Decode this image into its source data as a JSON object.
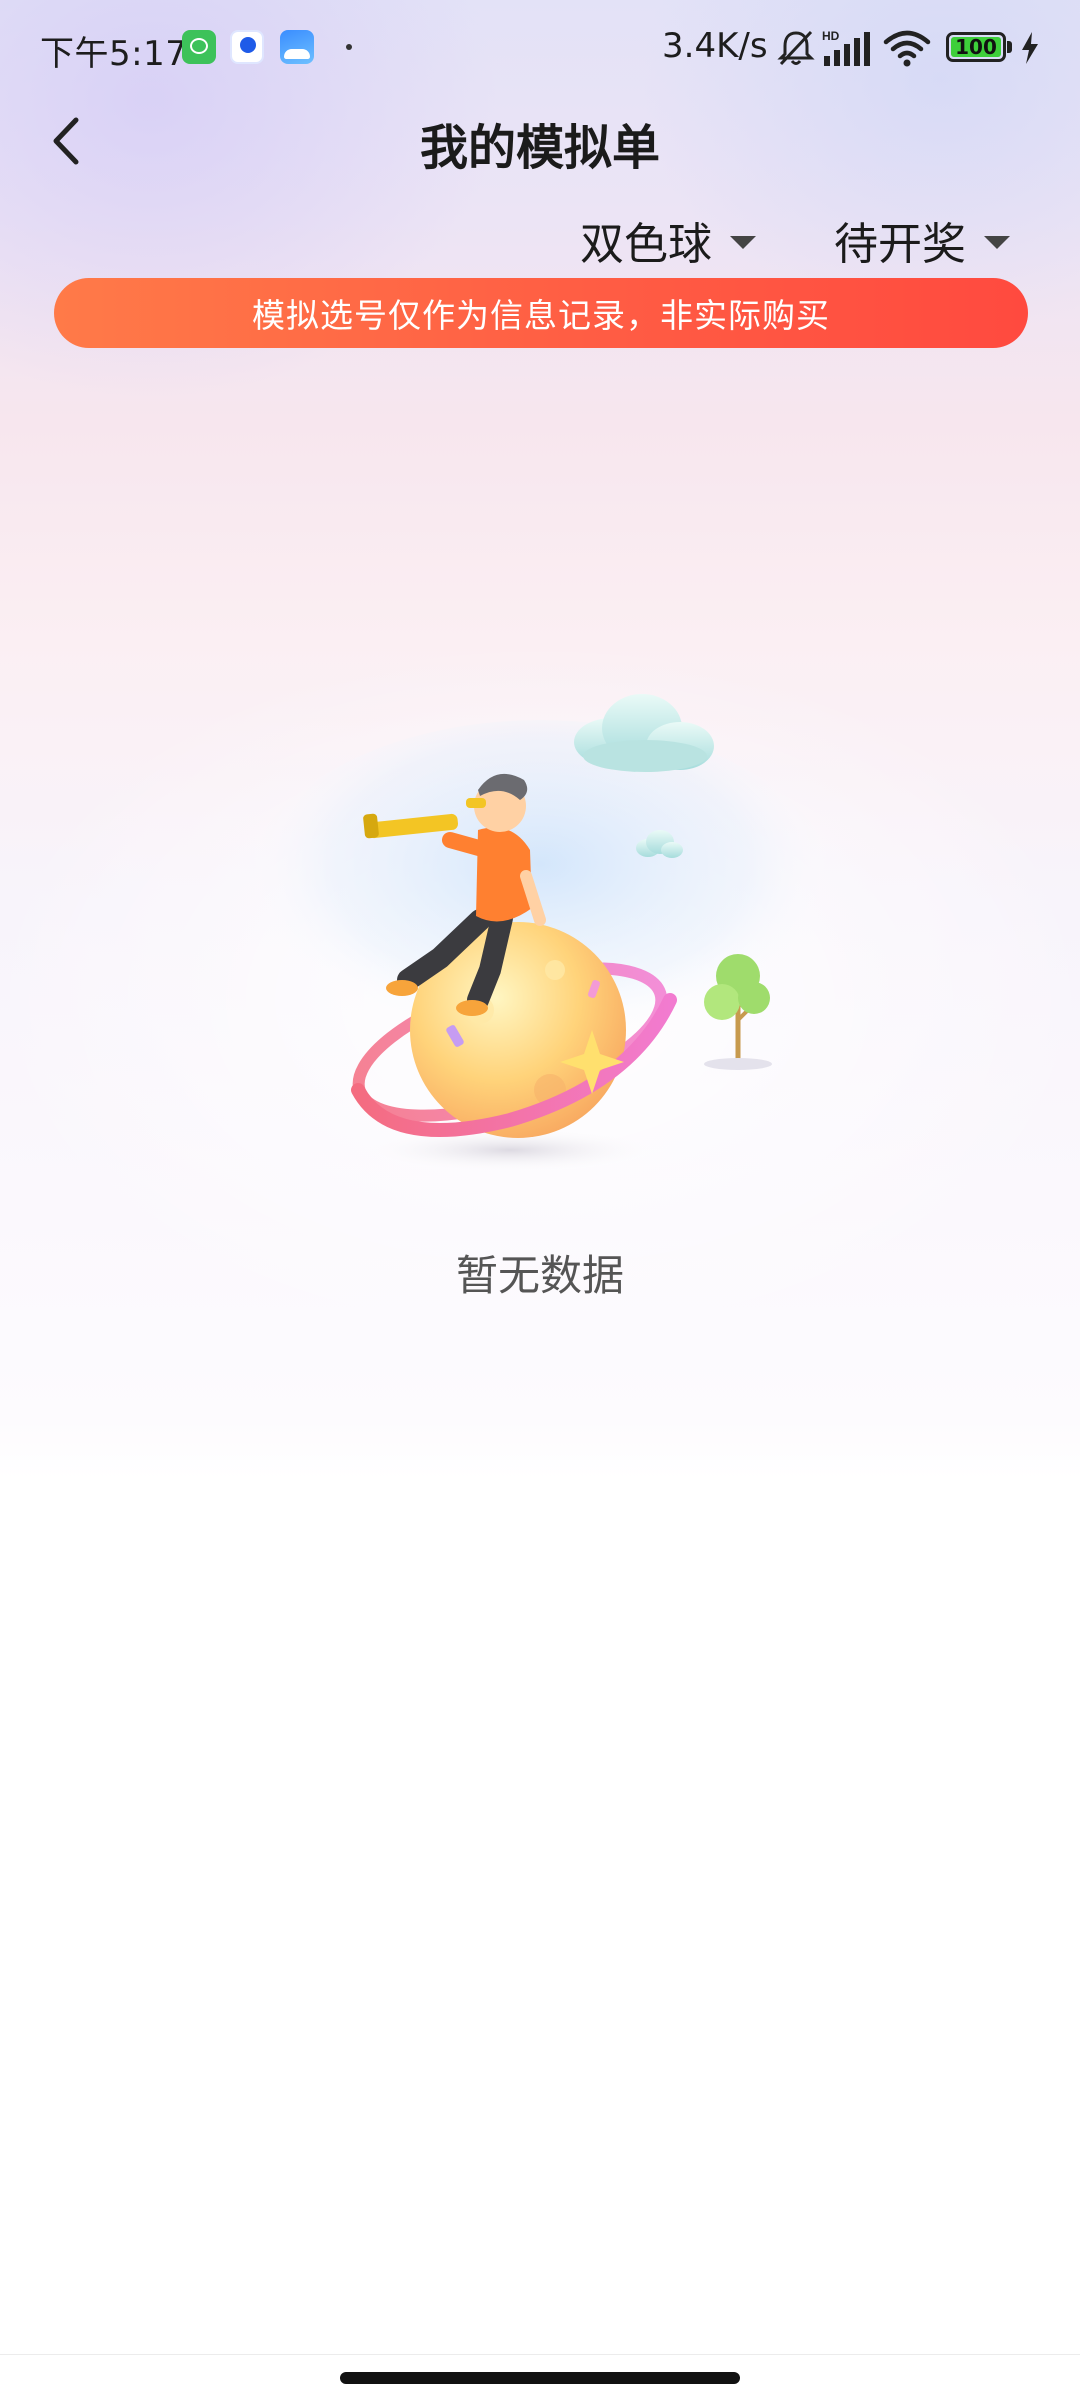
{
  "status_bar": {
    "time": "下午5:17",
    "net_speed": "3.4K/s",
    "battery": "100",
    "icons": [
      "wechat-app-icon",
      "baidu-app-icon",
      "cloud-app-icon",
      "mute-icon",
      "hd-signal-icon",
      "wifi-icon",
      "battery-icon",
      "charging-icon"
    ]
  },
  "header": {
    "title": "我的模拟单",
    "back_icon": "chevron-left-icon"
  },
  "filters": {
    "lottery": {
      "label": "双色球",
      "icon": "caret-down-icon"
    },
    "status": {
      "label": "待开奖",
      "icon": "caret-down-icon"
    }
  },
  "notice": {
    "text": "模拟选号仅作为信息记录，非实际购买",
    "colors": {
      "start": "#ff7a48",
      "end": "#ff4a3f"
    }
  },
  "empty_state": {
    "illustration": "astronaut-on-planet-illustration",
    "text": "暂无数据"
  }
}
